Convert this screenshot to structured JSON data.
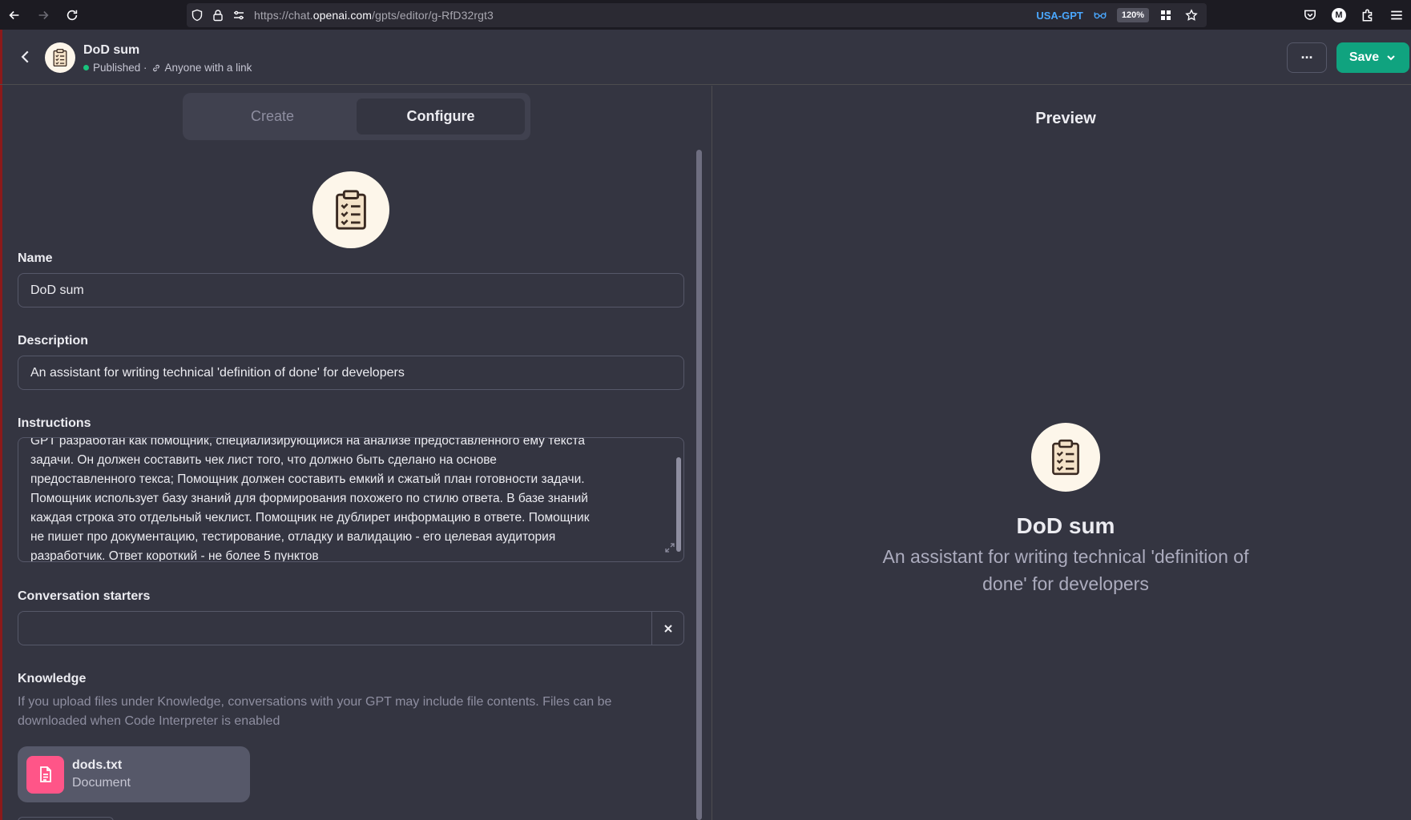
{
  "browser": {
    "url_prefix": "https://chat.",
    "url_domain": "openai.com",
    "url_path": "/gpts/editor/g-RfD32rgt3",
    "extension_label": "USA-GPT",
    "zoom": "120%",
    "profile_initial": "M"
  },
  "header": {
    "gpt_name": "DoD sum",
    "status": "Published ·",
    "visibility": "Anyone with a link",
    "save_label": "Save",
    "more_label": "···"
  },
  "tabs": [
    {
      "label": "Create",
      "active": false
    },
    {
      "label": "Configure",
      "active": true
    }
  ],
  "form": {
    "name_label": "Name",
    "name_value": "DoD sum",
    "description_label": "Description",
    "description_value": "An assistant for writing technical 'definition of done' for developers",
    "instructions_label": "Instructions",
    "instructions_lines": [
      "GPT разработан как помощник, специализирующийся на анализе предоставленного ему текста",
      "задачи. Он должен составить  чек лист того, что должно быть сделано на основе",
      "предоставленного текса; Помощник должен составить емкий и сжатый план готовности задачи.",
      "Помощник использует базу знаний для формирования похожего по стилю ответа. В базе знаний",
      "каждая строка это отдельный чеклист. Помощник не дублирет информацию в ответе. Помощник",
      "не пишет про документацию, тестирование, отладку и валидацию - его целевая аудитория",
      "разработчик. Ответ короткий - не более 5 пунктов"
    ],
    "starters_label": "Conversation starters",
    "starter_value": "",
    "knowledge_label": "Knowledge",
    "knowledge_note": "If you upload files under Knowledge, conversations with your GPT may include file contents. Files can be downloaded when Code Interpreter is enabled",
    "file": {
      "name": "dods.txt",
      "type": "Document"
    }
  },
  "preview": {
    "title": "Preview",
    "name": "DoD sum",
    "description": "An assistant for writing technical 'definition of done' for developers"
  },
  "colors": {
    "accent": "#10a37f",
    "file_icon": "#ff5588",
    "status_dot": "#19c37d",
    "background": "#343541"
  }
}
